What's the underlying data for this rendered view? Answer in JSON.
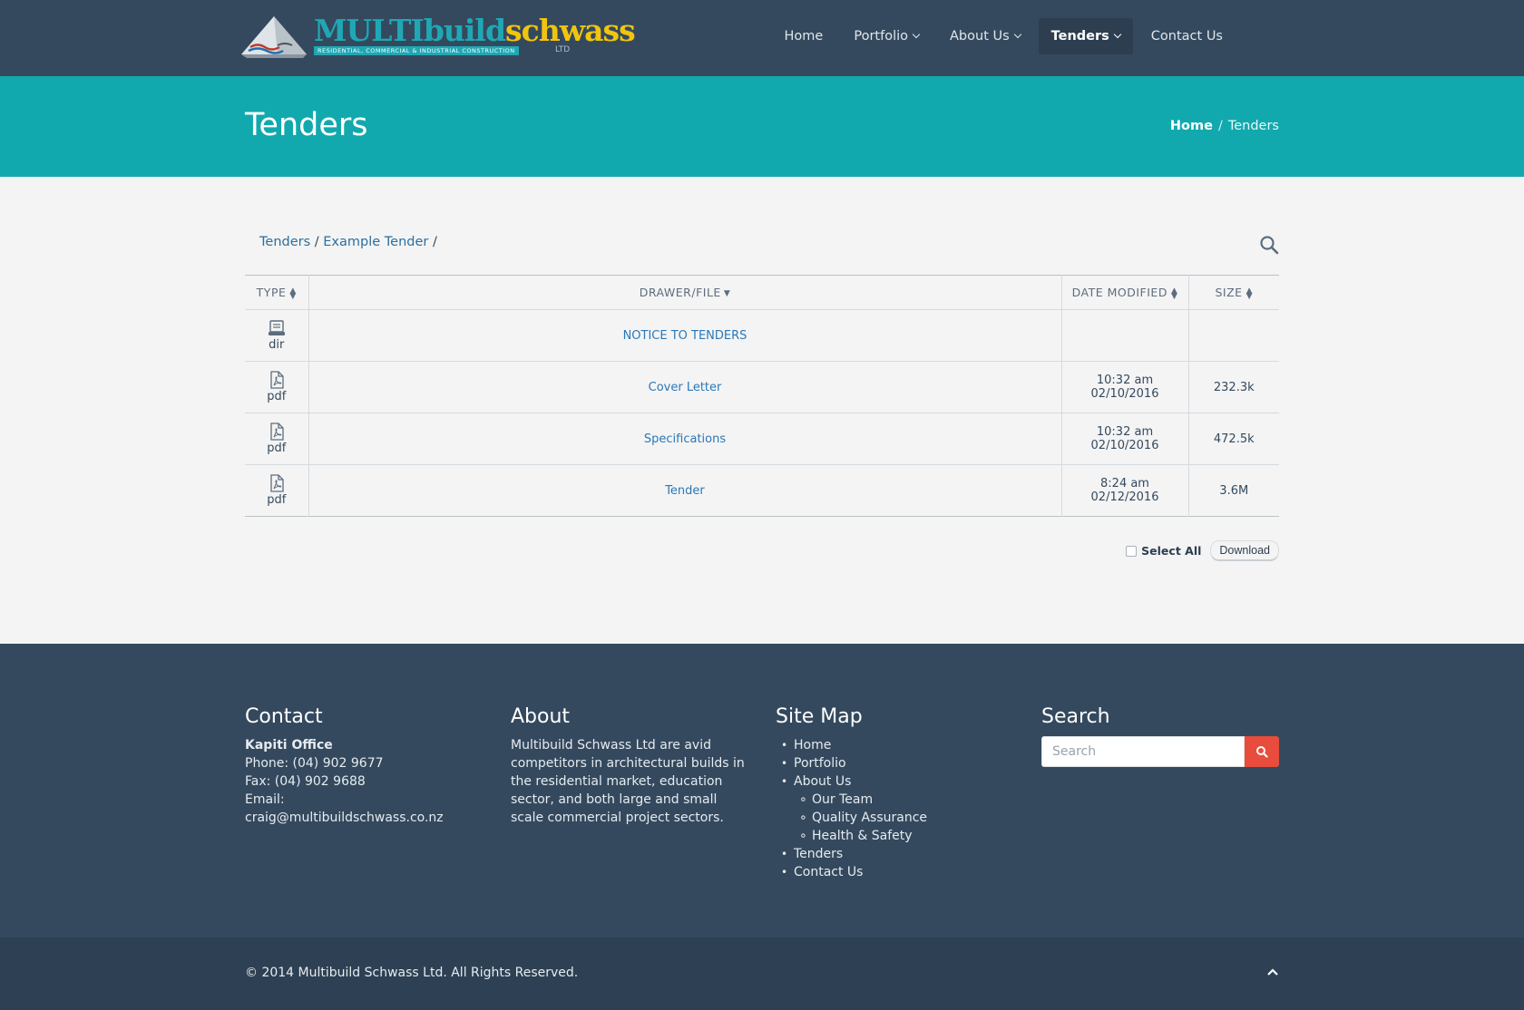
{
  "brand": {
    "name_part1": "MULTIbuild",
    "name_part2": "schwass",
    "tagline": "RESIDENTIAL, COMMERCIAL & INDUSTRIAL CONSTRUCTION",
    "suffix": "LTD"
  },
  "nav": {
    "items": [
      {
        "label": "Home",
        "has_dropdown": false,
        "active": false
      },
      {
        "label": "Portfolio",
        "has_dropdown": true,
        "active": false
      },
      {
        "label": "About Us",
        "has_dropdown": true,
        "active": false
      },
      {
        "label": "Tenders",
        "has_dropdown": true,
        "active": true
      },
      {
        "label": "Contact Us",
        "has_dropdown": false,
        "active": false
      }
    ]
  },
  "title_band": {
    "title": "Tenders",
    "breadcrumb": {
      "home": "Home",
      "separator": "/",
      "current": "Tenders"
    }
  },
  "file_browser": {
    "path": [
      {
        "label": "Tenders"
      },
      {
        "label": "Example Tender"
      }
    ],
    "path_separator": "/",
    "columns": {
      "type": "TYPE",
      "file": "DRAWER/FILE",
      "date": "DATE MODIFIED",
      "size": "SIZE"
    },
    "rows": [
      {
        "type": "dir",
        "icon": "drawer-icon",
        "name": "NOTICE TO TENDERS",
        "time": "",
        "date": "",
        "size": ""
      },
      {
        "type": "pdf",
        "icon": "pdf-file-icon",
        "name": "Cover Letter",
        "time": "10:32 am",
        "date": "02/10/2016",
        "size": "232.3k"
      },
      {
        "type": "pdf",
        "icon": "pdf-file-icon",
        "name": "Specifications",
        "time": "10:32 am",
        "date": "02/10/2016",
        "size": "472.5k"
      },
      {
        "type": "pdf",
        "icon": "pdf-file-icon",
        "name": "Tender",
        "time": "8:24 am",
        "date": "02/12/2016",
        "size": "3.6M"
      }
    ],
    "select_all_label": "Select All",
    "select_all_checked": false,
    "download_label": "Download"
  },
  "footer": {
    "contact": {
      "heading": "Contact",
      "office": "Kapiti Office",
      "phone": "Phone: (04) 902 9677",
      "fax": "Fax: (04) 902 9688",
      "email": "Email: craig@multibuildschwass.co.nz"
    },
    "about": {
      "heading": "About",
      "text": "Multibuild Schwass Ltd are avid competitors in architectural builds in the residential market, education sector, and both large and small scale commercial project sectors."
    },
    "sitemap": {
      "heading": "Site Map",
      "home": "Home",
      "portfolio": "Portfolio",
      "about": "About Us",
      "our_team": "Our Team",
      "quality": "Quality Assurance",
      "health": "Health & Safety",
      "tenders": "Tenders",
      "contact": "Contact Us"
    },
    "search": {
      "heading": "Search",
      "placeholder": "Search"
    },
    "copyright": "© 2014 Multibuild Schwass Ltd. All Rights Reserved."
  },
  "colors": {
    "header_bg": "#34495e",
    "accent_teal": "#12a9ae",
    "link_blue": "#2a78b8",
    "search_button": "#e74c3c",
    "logo_yellow": "#f1c40f"
  }
}
